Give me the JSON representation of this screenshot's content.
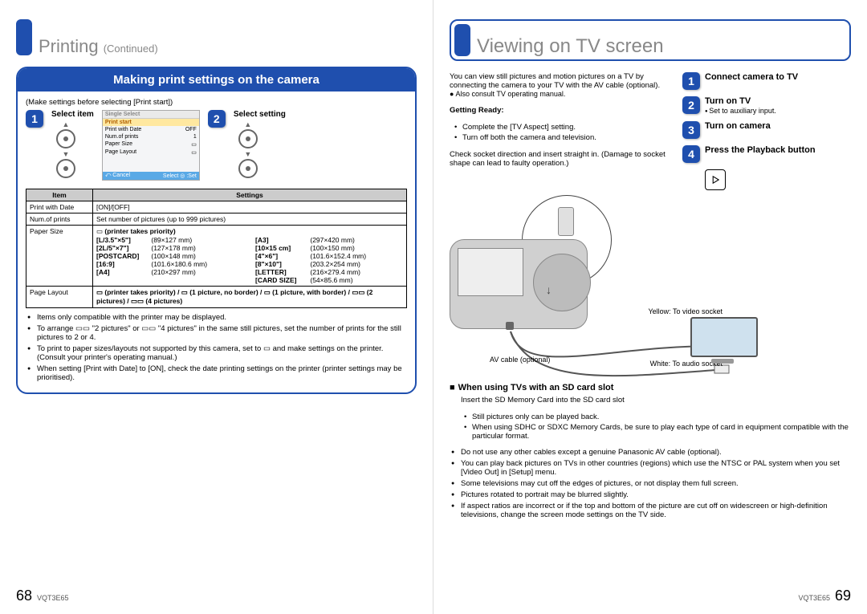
{
  "left": {
    "title_main": "Printing",
    "title_cont": "(Continued)",
    "panel_head": "Making print settings on the camera",
    "pre_note": "(Make settings before selecting [Print start])",
    "step1_label": "Select item",
    "step2_label": "Select setting",
    "mini": {
      "header": "Single Select",
      "rows": [
        {
          "k": "Print start",
          "v": ""
        },
        {
          "k": "Print with Date",
          "v": "OFF"
        },
        {
          "k": "Num.of prints",
          "v": "1"
        },
        {
          "k": "Paper Size",
          "v": "▭"
        },
        {
          "k": "Page Layout",
          "v": "▭"
        }
      ],
      "cancel": "Cancel",
      "select": "Select ◎ :Set"
    },
    "table_head_item": "Item",
    "table_head_settings": "Settings",
    "rows": {
      "print_with_date": {
        "item": "Print with Date",
        "val": "[ON]/[OFF]"
      },
      "num_of_prints": {
        "item": "Num.of prints",
        "val": "Set number of pictures (up to 999 pictures)"
      },
      "paper_size": {
        "item": "Paper Size",
        "lead": "(printer takes priority)",
        "col1": [
          {
            "n": "[L/3.5\"×5\"]",
            "d": "(89×127 mm)"
          },
          {
            "n": "[2L/5\"×7\"]",
            "d": "(127×178 mm)"
          },
          {
            "n": "[POSTCARD]",
            "d": "(100×148 mm)"
          },
          {
            "n": "[16:9]",
            "d": "(101.6×180.6 mm)"
          },
          {
            "n": "[A4]",
            "d": "(210×297 mm)"
          }
        ],
        "col2": [
          {
            "n": "[A3]",
            "d": "(297×420 mm)"
          },
          {
            "n": "[10×15 cm]",
            "d": "(100×150 mm)"
          },
          {
            "n": "[4\"×6\"]",
            "d": "(101.6×152.4 mm)"
          },
          {
            "n": "[8\"×10\"]",
            "d": "(203.2×254 mm)"
          },
          {
            "n": "[LETTER]",
            "d": "(216×279.4 mm)"
          },
          {
            "n": "[CARD SIZE]",
            "d": "(54×85.6 mm)"
          }
        ]
      },
      "page_layout": {
        "item": "Page Layout",
        "val": "▭ (printer takes priority) / ▭ (1 picture, no border) / ▭ (1 picture, with border) / ▭▭ (2 pictures) / ▭▭ (4 pictures)"
      }
    },
    "bullets": [
      "Items only compatible with the printer may be displayed.",
      "To arrange ▭▭ \"2 pictures\" or ▭▭ \"4 pictures\" in the same still pictures, set the number of prints for the still pictures to 2 or 4.",
      "To print to paper sizes/layouts not supported by this camera, set to ▭ and make settings on the printer. (Consult your printer's operating manual.)",
      "When setting [Print with Date] to [ON], check the date printing settings on the printer (printer settings may be prioritised)."
    ],
    "page_num": "68",
    "doc_id": "VQT3E65"
  },
  "right": {
    "title": "Viewing on TV screen",
    "intro": "You can view still pictures and motion pictures on a TV by connecting the camera to your TV with the AV cable (optional).",
    "intro_b": "Also consult TV operating manual.",
    "getting_ready": "Getting Ready:",
    "gr_list": [
      "Complete the [TV Aspect] setting.",
      "Turn off both the camera and television."
    ],
    "socket_note": "Check socket direction and insert straight in. (Damage to socket shape can lead to faulty operation.)",
    "steps": [
      {
        "n": "1",
        "t": "Connect camera to TV"
      },
      {
        "n": "2",
        "t": "Turn on TV",
        "sub": "Set to auxiliary input."
      },
      {
        "n": "3",
        "t": "Turn on camera"
      },
      {
        "n": "4",
        "t": "Press the Playback button"
      }
    ],
    "labels": {
      "yellow": "Yellow: To video socket",
      "white": "White: To audio socket",
      "av": "AV cable (optional)"
    },
    "sd_head": "When using TVs with an SD card slot",
    "sd_lead": "Insert the SD Memory Card into the SD card slot",
    "sd_items": [
      "Still pictures only can be played back.",
      "When using SDHC or SDXC Memory Cards, be sure to play each type of card in equipment compatible with the particular format."
    ],
    "notes": [
      "Do not use any other cables except a genuine Panasonic AV cable (optional).",
      "You can play back pictures on TVs in other countries (regions) which use the NTSC or PAL system when you set [Video Out] in [Setup] menu.",
      "Some televisions may cut off the edges of pictures, or not display them full screen.",
      "Pictures rotated to portrait may be blurred slightly.",
      "If aspect ratios are incorrect or if the top and bottom of the picture are cut off on widescreen or high-definition televisions, change the screen mode settings on the TV side."
    ],
    "page_num": "69",
    "doc_id": "VQT3E65"
  }
}
